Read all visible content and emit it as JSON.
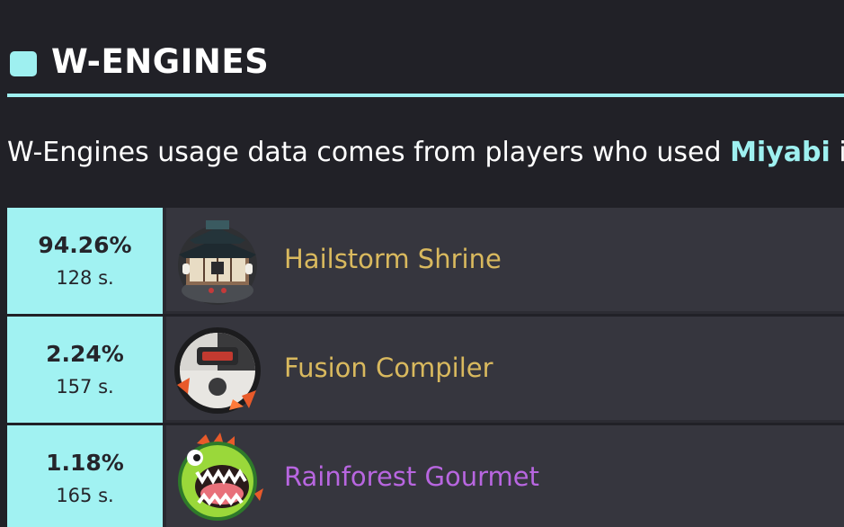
{
  "section": {
    "title": "W-ENGINES",
    "accent_color": "#9ef0f0"
  },
  "description": {
    "text_before": "W-Engines usage data comes from players who used ",
    "highlight": "Miyabi",
    "text_after": " i"
  },
  "engines": [
    {
      "usage_percent": "94.26%",
      "samples": "128 s.",
      "name": "Hailstorm Shrine",
      "rarity": "S",
      "name_color": "#d9b95e",
      "icon": "hailstorm-shrine-icon"
    },
    {
      "usage_percent": "2.24%",
      "samples": "157 s.",
      "name": "Fusion Compiler",
      "rarity": "S",
      "name_color": "#d9b95e",
      "icon": "fusion-compiler-icon"
    },
    {
      "usage_percent": "1.18%",
      "samples": "165 s.",
      "name": "Rainforest Gourmet",
      "rarity": "A",
      "name_color": "#b866e0",
      "icon": "rainforest-gourmet-icon"
    }
  ]
}
